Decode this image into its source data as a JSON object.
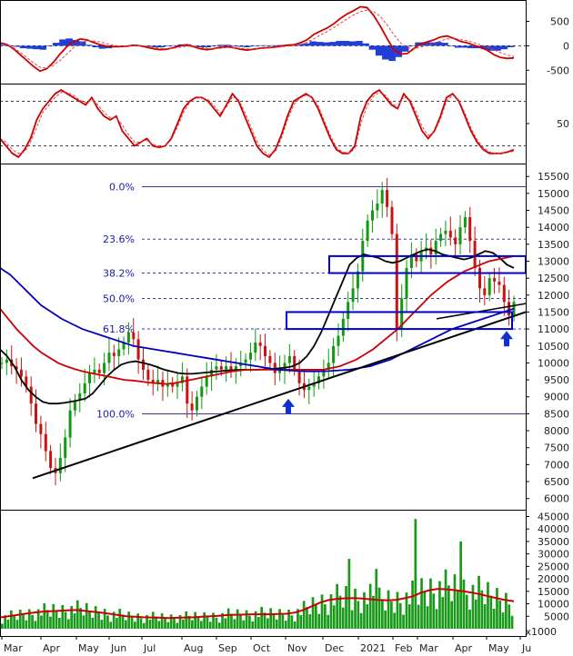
{
  "chart_data": [
    {
      "type": "line",
      "panel": "macd",
      "y_ticks": [
        "500",
        "0",
        "-500"
      ],
      "ylim": [
        -700,
        900
      ],
      "series": [
        {
          "color": "#cc0000",
          "values": [
            60,
            30,
            -60,
            -180,
            -300,
            -420,
            -520,
            -470,
            -340,
            -170,
            -20,
            80,
            140,
            120,
            70,
            20,
            -10,
            -20,
            -20,
            -10,
            10,
            0,
            -30,
            -60,
            -80,
            -70,
            -40,
            0,
            20,
            -20,
            -60,
            -80,
            -60,
            -30,
            -20,
            -40,
            -70,
            -90,
            -70,
            -50,
            -40,
            -30,
            -10,
            10,
            20,
            60,
            120,
            230,
            300,
            360,
            450,
            560,
            650,
            720,
            800,
            780,
            620,
            400,
            150,
            -80,
            -170,
            -160,
            -60,
            40,
            80,
            120,
            180,
            200,
            150,
            90,
            60,
            10,
            -30,
            -90,
            -180,
            -240,
            -260,
            -250
          ]
        },
        {
          "color": "#dd4444",
          "dash": "3,2",
          "values": [
            40,
            20,
            -40,
            -130,
            -240,
            -350,
            -440,
            -460,
            -400,
            -300,
            -170,
            -40,
            50,
            100,
            100,
            80,
            40,
            10,
            -10,
            -10,
            0,
            0,
            -10,
            -30,
            -50,
            -60,
            -50,
            -30,
            -10,
            -10,
            -30,
            -50,
            -60,
            -50,
            -40,
            -40,
            -50,
            -60,
            -65,
            -60,
            -50,
            -40,
            -25,
            -10,
            5,
            30,
            70,
            140,
            220,
            290,
            370,
            460,
            550,
            630,
            700,
            730,
            700,
            600,
            430,
            230,
            60,
            -40,
            -60,
            -30,
            10,
            50,
            100,
            140,
            150,
            130,
            100,
            60,
            20,
            -20,
            -80,
            -140,
            -190,
            -220
          ]
        }
      ],
      "histogram": [
        20,
        10,
        -20,
        -50,
        -60,
        -70,
        -80,
        -10,
        60,
        130,
        150,
        120,
        90,
        20,
        -30,
        -60,
        -50,
        -30,
        -10,
        0,
        10,
        0,
        -20,
        -30,
        -30,
        -10,
        10,
        30,
        30,
        -10,
        -30,
        -30,
        0,
        20,
        20,
        0,
        -20,
        -30,
        -5,
        10,
        10,
        10,
        15,
        20,
        15,
        30,
        50,
        90,
        80,
        70,
        80,
        100,
        100,
        90,
        100,
        50,
        -80,
        -200,
        -280,
        -310,
        -230,
        -120,
        0,
        70,
        70,
        70,
        80,
        60,
        0,
        -40,
        -40,
        -50,
        -50,
        -70,
        -100,
        -100,
        -70,
        -30
      ]
    },
    {
      "type": "line",
      "panel": "stochastic",
      "y_ticks": [
        "50"
      ],
      "ylim": [
        0,
        100
      ],
      "series": [
        {
          "color": "#cc0000",
          "values": [
            30,
            20,
            10,
            5,
            15,
            30,
            55,
            70,
            80,
            90,
            95,
            90,
            85,
            80,
            75,
            85,
            70,
            60,
            55,
            60,
            40,
            30,
            20,
            25,
            30,
            20,
            18,
            20,
            30,
            50,
            70,
            80,
            85,
            85,
            80,
            70,
            60,
            75,
            90,
            80,
            60,
            40,
            20,
            10,
            5,
            15,
            35,
            60,
            80,
            85,
            90,
            85,
            70,
            50,
            30,
            15,
            10,
            10,
            20,
            60,
            80,
            90,
            95,
            85,
            75,
            70,
            90,
            80,
            60,
            40,
            30,
            40,
            60,
            85,
            90,
            80,
            60,
            40,
            25,
            15,
            10,
            10,
            10,
            12,
            15
          ]
        },
        {
          "color": "#dd4444",
          "dash": "3,2",
          "values": [
            30,
            25,
            15,
            10,
            12,
            25,
            45,
            65,
            75,
            85,
            92,
            92,
            88,
            82,
            78,
            82,
            75,
            65,
            58,
            58,
            48,
            35,
            25,
            25,
            28,
            22,
            20,
            20,
            28,
            45,
            65,
            78,
            84,
            85,
            82,
            74,
            64,
            72,
            86,
            82,
            66,
            46,
            26,
            14,
            8,
            12,
            30,
            55,
            75,
            84,
            88,
            86,
            74,
            54,
            34,
            18,
            12,
            10,
            16,
            50,
            74,
            86,
            92,
            88,
            78,
            72,
            86,
            82,
            66,
            46,
            34,
            38,
            56,
            80,
            88,
            82,
            64,
            44,
            28,
            18,
            12,
            10,
            10,
            11,
            13
          ]
        }
      ]
    },
    {
      "type": "candlestick",
      "panel": "price",
      "y_ticks": [
        "15500",
        "15000",
        "14500",
        "14000",
        "13500",
        "13000",
        "12500",
        "12000",
        "11500",
        "11000",
        "10500",
        "10000",
        "9500",
        "9000",
        "8500",
        "8000",
        "7500",
        "7000",
        "6500",
        "6000"
      ],
      "ylim": [
        5750,
        15800
      ],
      "x_ticks": [
        "Mar",
        "Apr",
        "May",
        "Jun",
        "Jul",
        "Aug",
        "Sep",
        "Oct",
        "Nov",
        "Dec",
        "2021",
        "Feb",
        "Mar",
        "Apr",
        "May",
        "Ju"
      ],
      "close": [
        10000,
        10100,
        9900,
        9800,
        9600,
        9300,
        8800,
        8200,
        7900,
        7400,
        6900,
        6750,
        7200,
        7800,
        8600,
        8900,
        9100,
        9400,
        9700,
        9800,
        9700,
        10000,
        10300,
        10200,
        10400,
        10600,
        10900,
        10700,
        10100,
        9800,
        9500,
        9400,
        9500,
        9300,
        9400,
        9300,
        9400,
        9600,
        8800,
        8600,
        9000,
        9300,
        9600,
        9800,
        9900,
        9800,
        9900,
        9800,
        9900,
        10000,
        10100,
        10300,
        10600,
        10500,
        10200,
        10000,
        9700,
        9800,
        10000,
        10200,
        9800,
        9400,
        9200,
        9300,
        9400,
        9600,
        9800,
        10000,
        10500,
        10800,
        11300,
        11800,
        12200,
        12700,
        13600,
        14200,
        14500,
        14700,
        15100,
        14600,
        13800,
        11000,
        11900,
        12800,
        13200,
        13000,
        13300,
        13400,
        13200,
        13600,
        13800,
        13900,
        13700,
        13500,
        14000,
        14300,
        13600,
        12800,
        12200,
        12000,
        12500,
        12400,
        12300,
        11800,
        11400,
        11800
      ],
      "series": [
        {
          "color": "#000000",
          "values": [
            10400,
            10200,
            9900,
            9500,
            9200,
            9000,
            8850,
            8800,
            8800,
            8820,
            8860,
            8900,
            8950,
            9100,
            9350,
            9600,
            9800,
            9950,
            10020,
            10050,
            10000,
            9950,
            9880,
            9800,
            9750,
            9700,
            9680,
            9680,
            9700,
            9720,
            9740,
            9760,
            9780,
            9790,
            9800,
            9800,
            9800,
            9810,
            9820,
            9840,
            9860,
            9900,
            10000,
            10200,
            10500,
            10900,
            11400,
            11900,
            12400,
            12900,
            13100,
            13200,
            13150,
            13100,
            13000,
            12950,
            13000,
            13100,
            13200,
            13300,
            13350,
            13300,
            13200,
            13150,
            13100,
            13050,
            13100,
            13200,
            13300,
            13250,
            13100,
            12900,
            12800
          ]
        },
        {
          "color": "#cc0000",
          "values": [
            11600,
            11300,
            11000,
            10750,
            10500,
            10300,
            10150,
            10000,
            9900,
            9820,
            9750,
            9700,
            9650,
            9600,
            9550,
            9500,
            9480,
            9450,
            9420,
            9400,
            9380,
            9400,
            9450,
            9500,
            9550,
            9600,
            9650,
            9700,
            9750,
            9780,
            9800,
            9800,
            9800,
            9800,
            9800,
            9800,
            9800,
            9800,
            9800,
            9800,
            9850,
            9900,
            10000,
            10100,
            10250,
            10400,
            10600,
            10800,
            11000,
            11250,
            11500,
            11750,
            12000,
            12200,
            12400,
            12550,
            12700,
            12800,
            12900,
            13000,
            13050,
            13100,
            13150
          ]
        },
        {
          "color": "#0000bb",
          "values": [
            12800,
            12600,
            12300,
            12000,
            11700,
            11500,
            11300,
            11150,
            11000,
            10900,
            10800,
            10700,
            10600,
            10500,
            10450,
            10400,
            10350,
            10300,
            10250,
            10200,
            10150,
            10100,
            10050,
            10000,
            9950,
            9900,
            9850,
            9800,
            9780,
            9760,
            9750,
            9750,
            9760,
            9780,
            9800,
            9850,
            9900,
            10000,
            10100,
            10250,
            10400,
            10550,
            10700,
            10850,
            11000,
            11100,
            11200,
            11300,
            11400,
            11500,
            11600
          ]
        }
      ],
      "fibonacci": [
        {
          "label": "0.0%",
          "value": 15200
        },
        {
          "label": "23.6%",
          "value": 13650
        },
        {
          "label": "38.2%",
          "value": 12650
        },
        {
          "label": "50.0%",
          "value": 11900
        },
        {
          "label": "61.8%",
          "value": 11000
        },
        {
          "label": "100.0%",
          "value": 8500
        }
      ]
    },
    {
      "type": "bar",
      "panel": "volume",
      "y_ticks": [
        "45000",
        "40000",
        "35000",
        "30000",
        "25000",
        "20000",
        "15000",
        "10000",
        "5000"
      ],
      "ylim": [
        0,
        47000
      ],
      "unit_label": "x1000",
      "ma_color": "#cc0000",
      "ma": [
        4500,
        5000,
        5500,
        6000,
        6500,
        6800,
        7000,
        7200,
        7400,
        7500,
        7200,
        6800,
        6500,
        6000,
        5500,
        5000,
        4800,
        4600,
        4500,
        4400,
        4300,
        4400,
        4500,
        4600,
        4800,
        5000,
        5200,
        5500,
        5600,
        5700,
        5800,
        5800,
        5800,
        5900,
        6000,
        6500,
        7500,
        9000,
        10500,
        11500,
        12000,
        12200,
        12300,
        12100,
        11800,
        11500,
        11400,
        11600,
        12200,
        13000,
        14500,
        15500,
        16000,
        15800,
        15500,
        15000,
        14500,
        13800,
        13000,
        12200,
        11500,
        11000
      ]
    }
  ]
}
